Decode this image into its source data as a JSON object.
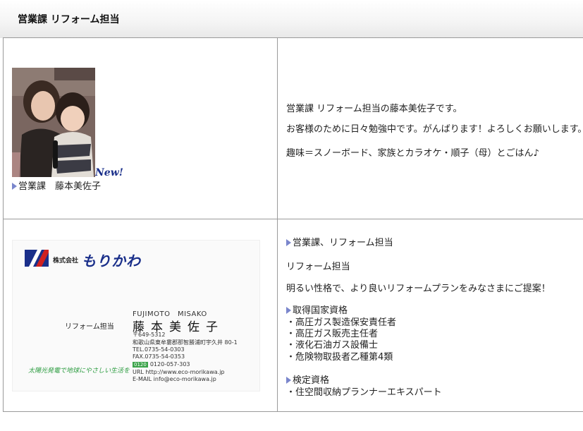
{
  "section": {
    "title": "営業課 リフォーム担当"
  },
  "profile": {
    "new_badge": "New!",
    "caption": "営業課　藤本美佐子",
    "lines": [
      "営業課 リフォーム担当の藤本美佐子です。",
      "お客様のために日々勉強中です。がんばります！よろしくお願いします。",
      "趣味＝スノーボード、家族とカラオケ・順子（母）とごはん♪"
    ]
  },
  "card": {
    "company_prefix": "株式会社",
    "company_name": "もりかわ",
    "department": "リフォーム担当",
    "name_romaji": "FUJIMOTO　MISAKO",
    "name_kanji": "藤本美佐子",
    "postal": "〒649-5312",
    "address": "和歌山県東牟婁郡那智勝浦町宇久井 80-1",
    "tel": "TEL.0735-54-0303",
    "fax": "FAX.0735-54-0353",
    "free_dial_label": "0120",
    "free_dial": "0120-057-303",
    "url": "URL http://www.eco-morikawa.jp",
    "email": "E-MAIL info@eco-morikawa.jp",
    "slogan": "太陽光発電で地球にやさしい生活を"
  },
  "details": {
    "heading": "営業課、リフォーム担当",
    "role": "リフォーム担当",
    "intro": "明るい性格で、より良いリフォームプランをみなさまにご提案！",
    "qual_heading": "取得国家資格",
    "qualifications": [
      "・高圧ガス製造保安責任者",
      "・高圧ガス販売主任者",
      "・液化石油ガス設備士",
      "・危険物取扱者乙種第4類"
    ],
    "cert_heading": "検定資格",
    "certifications": [
      "・住空間収納プランナーエキスパート"
    ]
  },
  "colors": {
    "bullet": "#7a86cc",
    "logo_blue": "#1a2f8a",
    "logo_red": "#d02020",
    "slogan_green": "#2c9c40",
    "border": "#9a9a9a"
  },
  "icons": {
    "bullet": "triangle-right-icon",
    "logo": "company-logo-mark"
  }
}
